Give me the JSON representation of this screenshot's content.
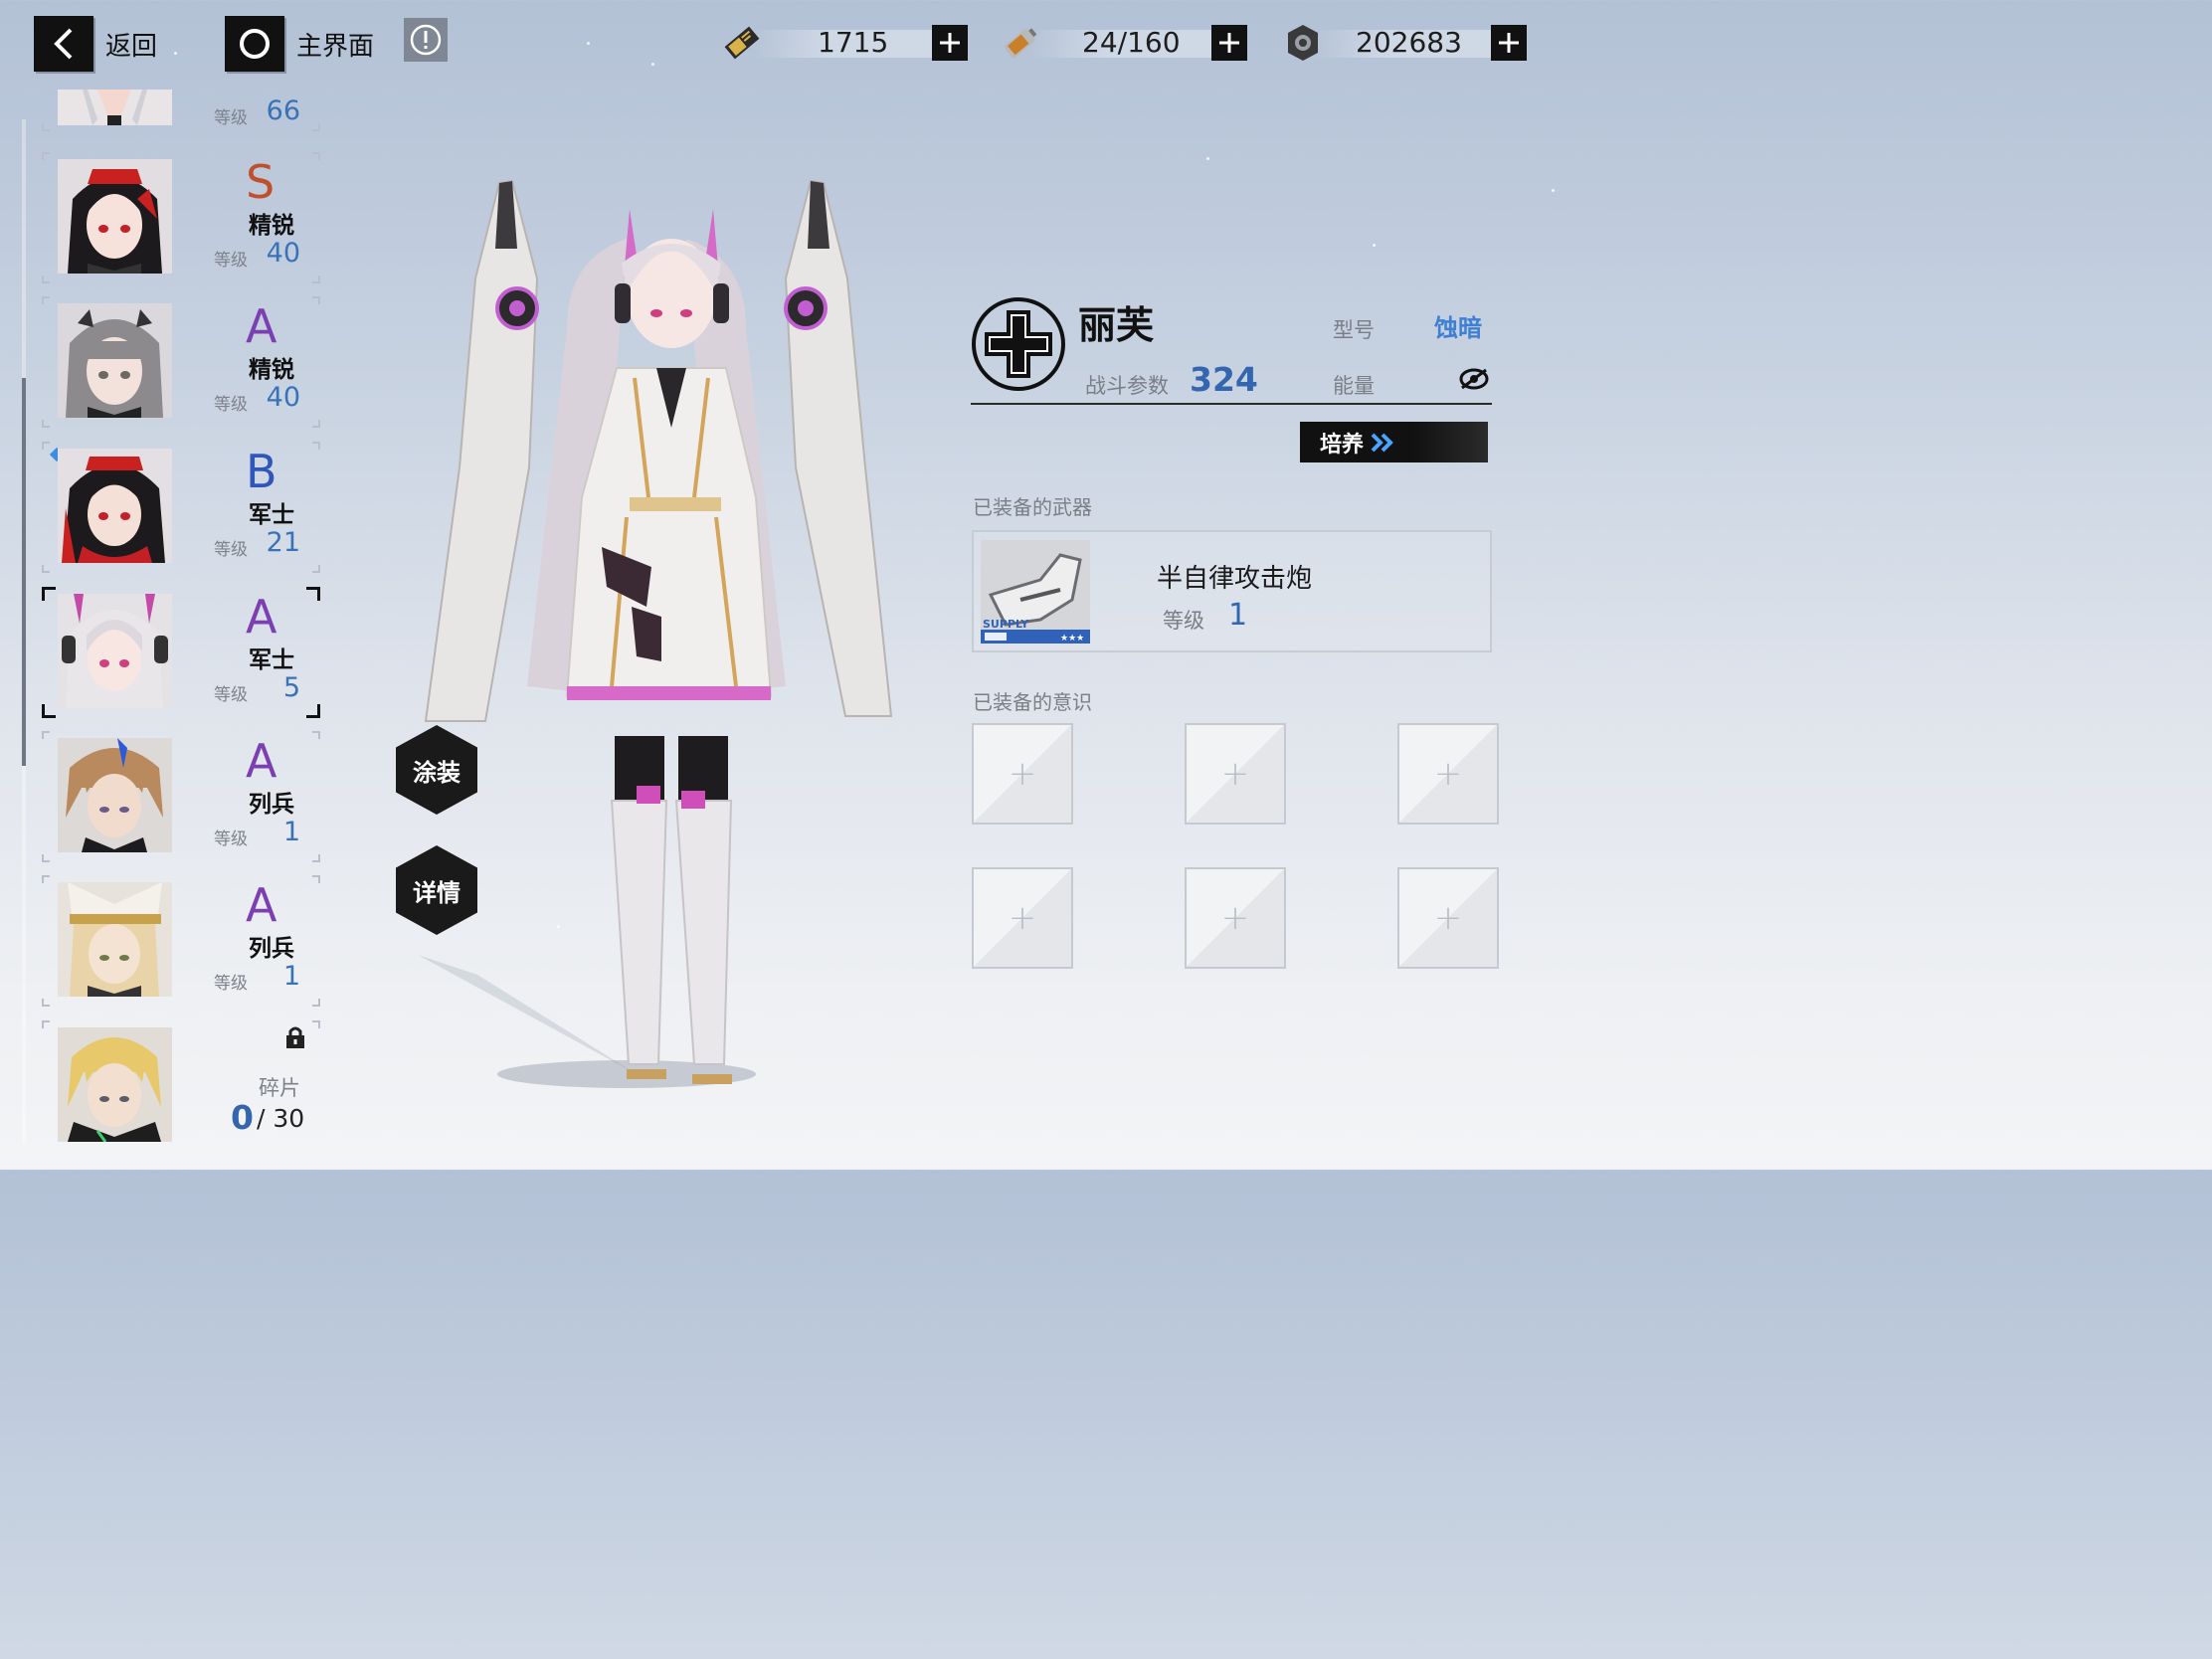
{
  "topbar": {
    "back_label": "返回",
    "home_label": "主界面",
    "resources": [
      {
        "icon": "gold-ticket-icon",
        "value": "1715"
      },
      {
        "icon": "energy-battery-icon",
        "value": "24/160"
      },
      {
        "icon": "gear-coin-icon",
        "value": "202683"
      }
    ]
  },
  "roster": {
    "level_label": "等级",
    "shard_label": "碎片",
    "cards": [
      {
        "rank": "",
        "title": "",
        "level": "66",
        "rank_color": "#7b3fb0"
      },
      {
        "rank": "S",
        "title": "精锐",
        "level": "40",
        "rank_color": "#c0502c"
      },
      {
        "rank": "A",
        "title": "精锐",
        "level": "40",
        "rank_color": "#7b3fb0"
      },
      {
        "rank": "B",
        "title": "军士",
        "level": "21",
        "rank_color": "#2f56b8"
      },
      {
        "rank": "A",
        "title": "军士",
        "level": "5",
        "rank_color": "#7b3fb0",
        "selected": true
      },
      {
        "rank": "A",
        "title": "列兵",
        "level": "1",
        "rank_color": "#7b3fb0"
      },
      {
        "rank": "A",
        "title": "列兵",
        "level": "1",
        "rank_color": "#7b3fb0"
      }
    ],
    "locked_card": {
      "shards_current": "0",
      "shards_total": "/ 30"
    }
  },
  "center": {
    "skin_button": "涂装",
    "detail_button": "详情"
  },
  "info": {
    "name": "丽芙",
    "power_label": "战斗参数",
    "power_value": "324",
    "model_label": "型号",
    "model_value": "蚀暗",
    "energy_label": "能量",
    "train_button": "培养",
    "weapon_section": "已装备的武器",
    "weapon_name": "半自律攻击炮",
    "weapon_level_label": "等级",
    "weapon_level_value": "1",
    "weapon_tag": "SUPPLY",
    "memory_section": "已装备的意识"
  },
  "colors": {
    "accent_blue": "#3466b0",
    "rank_purple": "#7b3fb0",
    "rank_orange": "#c0502c",
    "rank_blue": "#2f56b8"
  }
}
